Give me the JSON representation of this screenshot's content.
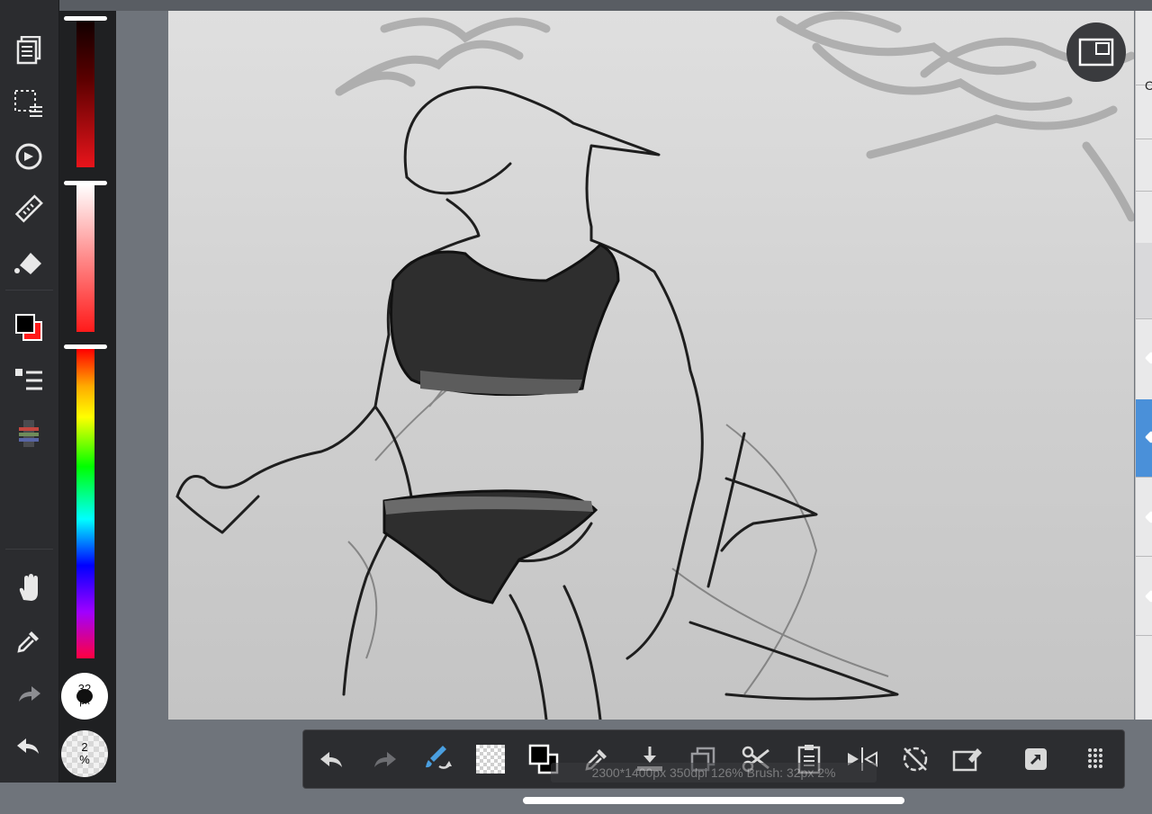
{
  "left_toolbar": {
    "tools": [
      {
        "name": "layer-menu-icon"
      },
      {
        "name": "selection-icon"
      },
      {
        "name": "transform-icon"
      },
      {
        "name": "ruler-icon"
      },
      {
        "name": "fill-bucket-icon"
      },
      {
        "name": "color-swatch-icon"
      },
      {
        "name": "layer-list-icon"
      },
      {
        "name": "material-icon"
      },
      {
        "name": "hand-icon"
      },
      {
        "name": "eyedropper-icon"
      },
      {
        "name": "redo-icon"
      },
      {
        "name": "undo-icon"
      }
    ],
    "foreground_color": "#000000",
    "background_color": "#ff1a1a"
  },
  "color_sliders": {
    "brush_size_value": "32",
    "brush_size_unit": "px",
    "opacity_value": "2",
    "opacity_unit": "%",
    "accent_red": "#e8141b"
  },
  "bottom_toolbar": {
    "buttons": [
      "undo-icon",
      "redo-icon",
      "brush-tool-icon",
      "transparent-icon",
      "color-swap-icon",
      "eyedropper-icon",
      "download-icon",
      "copy-icon",
      "cut-icon",
      "paste-icon",
      "flip-horizontal-icon",
      "rotate-off-icon",
      "eraser-box-icon",
      "export-icon",
      "grid-menu-icon"
    ],
    "status_text": "2300*1400px 350dpi 126% Brush: 32px 2%"
  },
  "right_panel": {
    "partial_label": "C"
  }
}
